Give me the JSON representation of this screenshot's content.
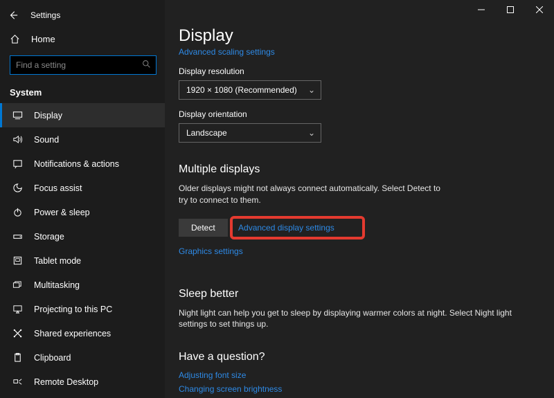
{
  "window": {
    "app_title": "Settings",
    "home_label": "Home",
    "search_placeholder": "Find a setting",
    "group_label": "System"
  },
  "sidebar": {
    "items": [
      {
        "label": "Display"
      },
      {
        "label": "Sound"
      },
      {
        "label": "Notifications & actions"
      },
      {
        "label": "Focus assist"
      },
      {
        "label": "Power & sleep"
      },
      {
        "label": "Storage"
      },
      {
        "label": "Tablet mode"
      },
      {
        "label": "Multitasking"
      },
      {
        "label": "Projecting to this PC"
      },
      {
        "label": "Shared experiences"
      },
      {
        "label": "Clipboard"
      },
      {
        "label": "Remote Desktop"
      }
    ]
  },
  "main": {
    "page_title": "Display",
    "scaling_link": "Advanced scaling settings",
    "resolution_label": "Display resolution",
    "resolution_value": "1920 × 1080 (Recommended)",
    "orientation_label": "Display orientation",
    "orientation_value": "Landscape",
    "multi_header": "Multiple displays",
    "multi_body": "Older displays might not always connect automatically. Select Detect to try to connect to them.",
    "detect_label": "Detect",
    "adv_display_link": "Advanced display settings",
    "graphics_link": "Graphics settings",
    "sleep_header": "Sleep better",
    "sleep_body": "Night light can help you get to sleep by displaying warmer colors at night. Select Night light settings to set things up.",
    "question_header": "Have a question?",
    "help_links": [
      "Adjusting font size",
      "Changing screen brightness"
    ]
  }
}
